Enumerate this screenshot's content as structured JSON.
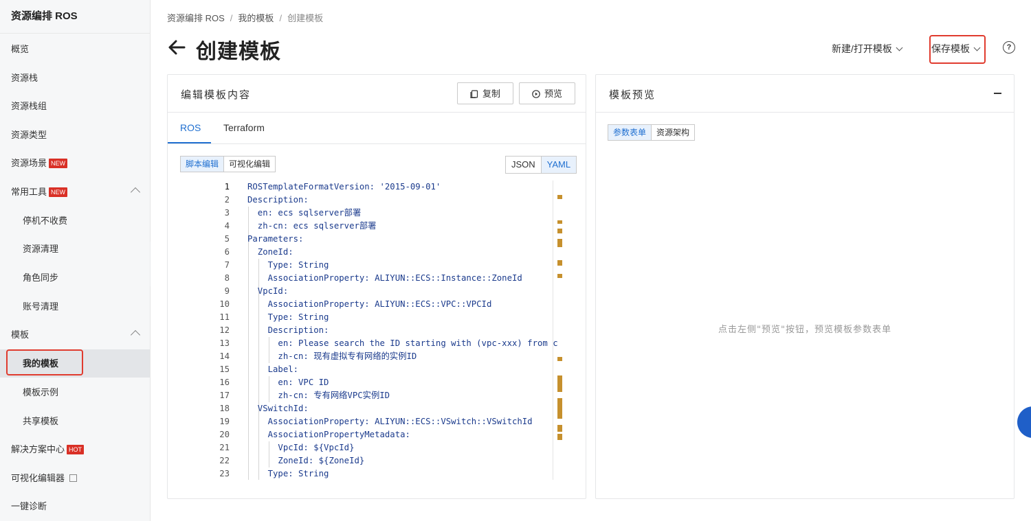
{
  "sidebar": {
    "title": "资源编排 ROS",
    "items": [
      {
        "label": "概览"
      },
      {
        "label": "资源栈"
      },
      {
        "label": "资源栈组"
      },
      {
        "label": "资源类型"
      },
      {
        "label": "资源场景",
        "badge": "NEW"
      },
      {
        "label": "常用工具",
        "badge": "NEW"
      },
      {
        "label": "停机不收费"
      },
      {
        "label": "资源清理"
      },
      {
        "label": "角色同步"
      },
      {
        "label": "账号清理"
      },
      {
        "label": "模板"
      },
      {
        "label": "我的模板"
      },
      {
        "label": "模板示例"
      },
      {
        "label": "共享模板"
      },
      {
        "label": "解决方案中心",
        "badge": "HOT"
      },
      {
        "label": "可视化编辑器"
      },
      {
        "label": "一键诊断"
      }
    ]
  },
  "breadcrumb": [
    "资源编排 ROS",
    "我的模板",
    "创建模板"
  ],
  "breadcrumb_sep": "/",
  "page_title": "创建模板",
  "actions": {
    "new_open": "新建/打开模板",
    "save": "保存模板",
    "help": "?"
  },
  "editor_panel": {
    "title": "编辑模板内容",
    "copy_label": "复制",
    "preview_label": "预览",
    "tabs": [
      "ROS",
      "Terraform"
    ],
    "modes": [
      "脚本编辑",
      "可视化编辑"
    ],
    "formats": [
      "JSON",
      "YAML"
    ],
    "lines": [
      {
        "n": "1",
        "code": "ROSTemplateFormatVersion: '2015-09-01'"
      },
      {
        "n": "2",
        "code": "Description:"
      },
      {
        "n": "3",
        "code": "  en: ecs sqlserver部署"
      },
      {
        "n": "4",
        "code": "  zh-cn: ecs sqlserver部署"
      },
      {
        "n": "5",
        "code": "Parameters:"
      },
      {
        "n": "6",
        "code": "  ZoneId:"
      },
      {
        "n": "7",
        "code": "    Type: String"
      },
      {
        "n": "8",
        "code": "    AssociationProperty: ALIYUN::ECS::Instance::ZoneId"
      },
      {
        "n": "9",
        "code": "  VpcId:"
      },
      {
        "n": "10",
        "code": "    AssociationProperty: ALIYUN::ECS::VPC::VPCId"
      },
      {
        "n": "11",
        "code": "    Type: String"
      },
      {
        "n": "12",
        "code": "    Description:"
      },
      {
        "n": "13",
        "code": "      en: Please search the ID starting with (vpc-xxx) from c"
      },
      {
        "n": "14",
        "code": "      zh-cn: 现有虚拟专有网络的实例ID"
      },
      {
        "n": "15",
        "code": "    Label:"
      },
      {
        "n": "16",
        "code": "      en: VPC ID"
      },
      {
        "n": "17",
        "code": "      zh-cn: 专有网络VPC实例ID"
      },
      {
        "n": "18",
        "code": "  VSwitchId:"
      },
      {
        "n": "19",
        "code": "    AssociationProperty: ALIYUN::ECS::VSwitch::VSwitchId"
      },
      {
        "n": "20",
        "code": "    AssociationPropertyMetadata:"
      },
      {
        "n": "21",
        "code": "      VpcId: ${VpcId}"
      },
      {
        "n": "22",
        "code": "      ZoneId: ${ZoneId}"
      },
      {
        "n": "23",
        "code": "    Type: String"
      }
    ]
  },
  "preview_panel": {
    "title": "模板预览",
    "tabs": [
      "参数表单",
      "资源架构"
    ],
    "empty_text": "点击左侧\"预览\"按钮，预览模板参数表单"
  },
  "colors": {
    "accent": "#1f6fd0",
    "badge": "#d93026",
    "highlight_box": "#e03b2e",
    "overview_marker": "#c6902d"
  }
}
